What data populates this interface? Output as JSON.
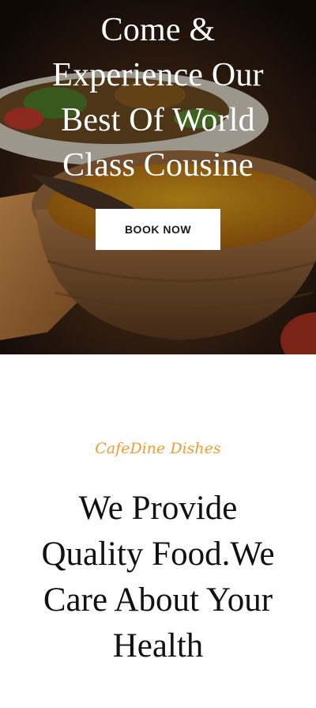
{
  "hero": {
    "title_lines": [
      "Come &",
      "Experience Our",
      "Best Of World",
      "Class Cousine"
    ],
    "button_label": "BOOK NOW"
  },
  "about": {
    "tagline": "CafeDine Dishes",
    "heading_lines": [
      "We Provide",
      "Quality Food.We",
      "Care About Your",
      "Health"
    ]
  },
  "colors": {
    "tagline": "#f39a2e",
    "button_bg": "#ffffff",
    "heading": "#111111"
  }
}
